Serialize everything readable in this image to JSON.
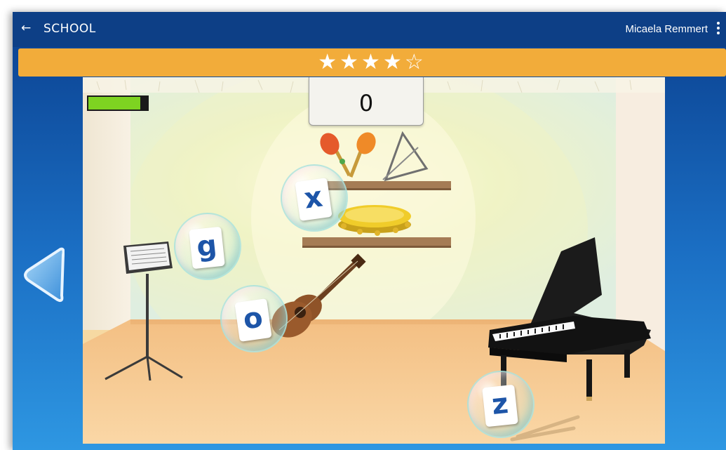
{
  "header": {
    "title": "SCHOOL",
    "back_icon": "arrow-left-icon",
    "user_name": "Micaela Remmert",
    "menu_icon": "kebab-menu-icon"
  },
  "rating": {
    "stars_filled": 4,
    "stars_total": 5,
    "display": "★★★★☆"
  },
  "game": {
    "score": "0",
    "timer_fraction": 0.88,
    "letters": [
      {
        "name": "bubble-letter-x",
        "letter": "x"
      },
      {
        "name": "bubble-letter-g",
        "letter": "g"
      },
      {
        "name": "bubble-letter-o",
        "letter": "o"
      },
      {
        "name": "bubble-letter-z",
        "letter": "z"
      }
    ],
    "nav_icon": "left-arrow-icon"
  },
  "colors": {
    "header_bg": "#0d3f86",
    "star_bar": "#f2ac3a",
    "timer_fill": "#7ed321",
    "letter": "#1d55a8",
    "floor": "#f6c68a"
  }
}
